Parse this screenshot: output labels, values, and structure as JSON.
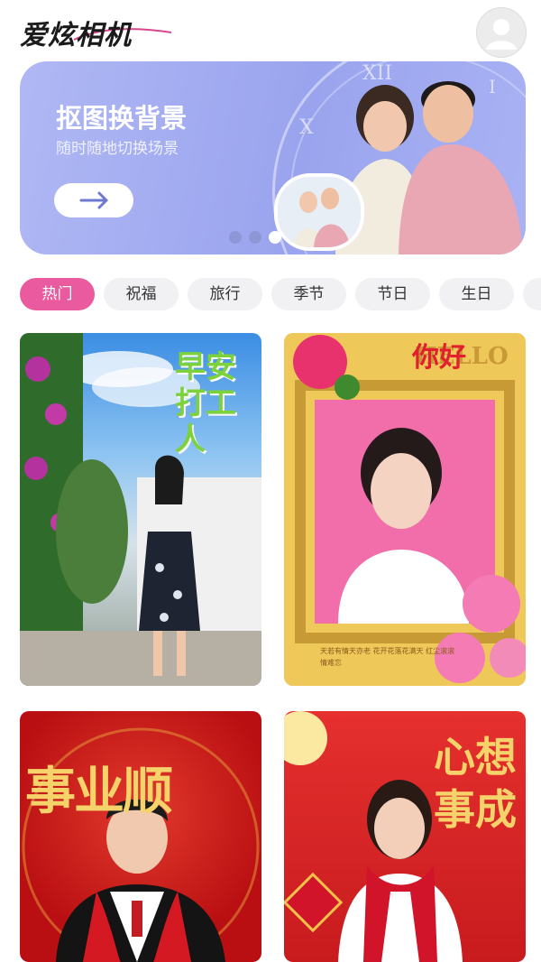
{
  "app": {
    "title": "爱炫相机"
  },
  "banner": {
    "title": "抠图换背景",
    "subtitle": "随时随地切换场景",
    "button_icon": "arrow-right-icon",
    "dots_count": 3,
    "active_dot": 3
  },
  "categories": [
    "热门",
    "祝福",
    "旅行",
    "季节",
    "节日",
    "生日"
  ],
  "active_category": 0,
  "cards": [
    {
      "overlay_text": "早安打工人",
      "theme": "travel-garden"
    },
    {
      "overlay_text": "你好",
      "frame_text": "HELLO",
      "caption": "天若有情天亦老 花开花落花满天 红尘滚滚情难忘",
      "theme": "golden-frame-roses"
    },
    {
      "overlay_text": "事业顺",
      "theme": "new-year-red"
    },
    {
      "overlay_text": "心想事成",
      "theme": "new-year-red-lantern"
    }
  ],
  "colors": {
    "accent": "#ea5a9e",
    "banner_bg": "#a4adf1"
  }
}
